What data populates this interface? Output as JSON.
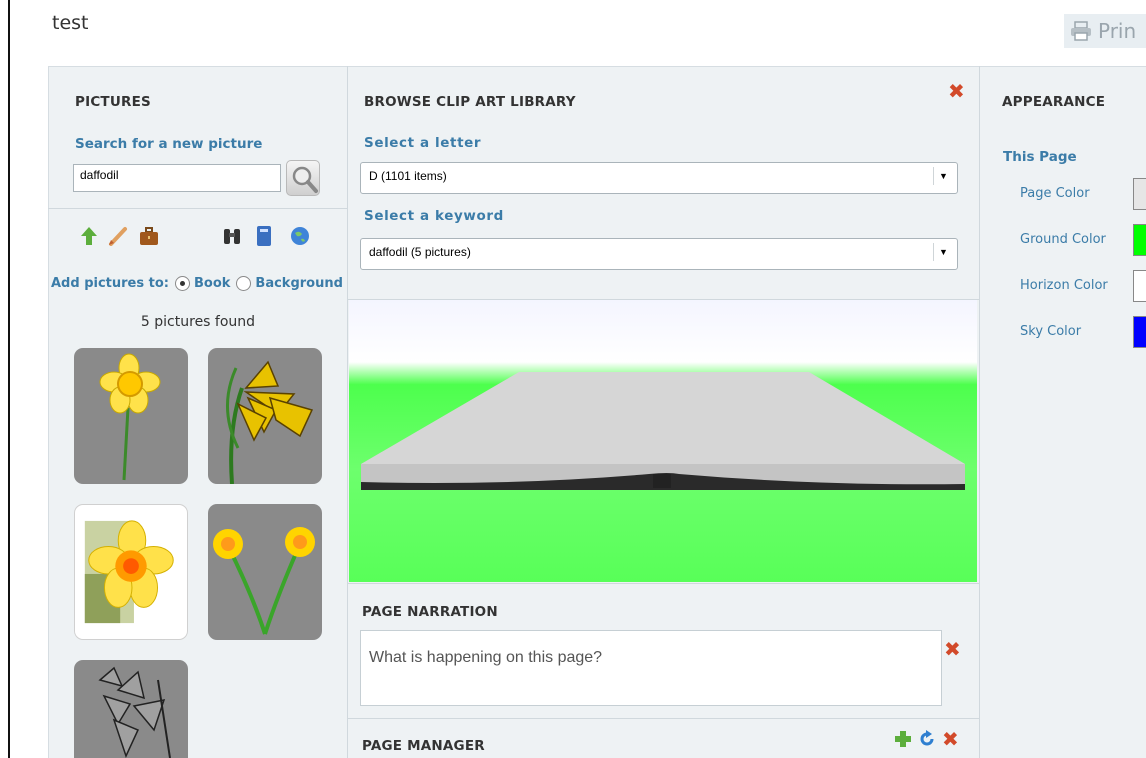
{
  "document": {
    "title": "test",
    "print_label": "Prin"
  },
  "pictures": {
    "heading": "PICTURES",
    "search_label": "Search for a new picture",
    "search_value": "daffodil",
    "toolbar_icons": [
      "up-arrow-icon",
      "pencil-icon",
      "briefcase-icon",
      "binoculars-icon",
      "book-icon",
      "globe-icon"
    ],
    "add_to_label": "Add pictures to:",
    "add_to_options": [
      {
        "label": "Book",
        "selected": true
      },
      {
        "label": "Background",
        "selected": false
      }
    ],
    "results_text": "5 pictures found"
  },
  "clipart": {
    "heading": "BROWSE CLIP ART LIBRARY",
    "letter_label": "Select a letter",
    "letter_value": "D (1101 items)",
    "keyword_label": "Select a keyword",
    "keyword_value": "daffodil (5 pictures)"
  },
  "narration": {
    "heading": "PAGE NARRATION",
    "placeholder": "What is happening on this page?"
  },
  "page_manager": {
    "heading": "PAGE MANAGER"
  },
  "appearance": {
    "heading": "APPEARANCE",
    "section": "This Page",
    "items": [
      {
        "label": "Page Color",
        "color": "#e6e6e6"
      },
      {
        "label": "Ground Color",
        "color": "#00ff00"
      },
      {
        "label": "Horizon Color",
        "color": "#ffffff"
      },
      {
        "label": "Sky Color",
        "color": "#0000ff"
      }
    ]
  },
  "colors": {
    "accent": "#3b7ca8",
    "delete": "#d24a2a",
    "ground": "#4dff4d"
  }
}
